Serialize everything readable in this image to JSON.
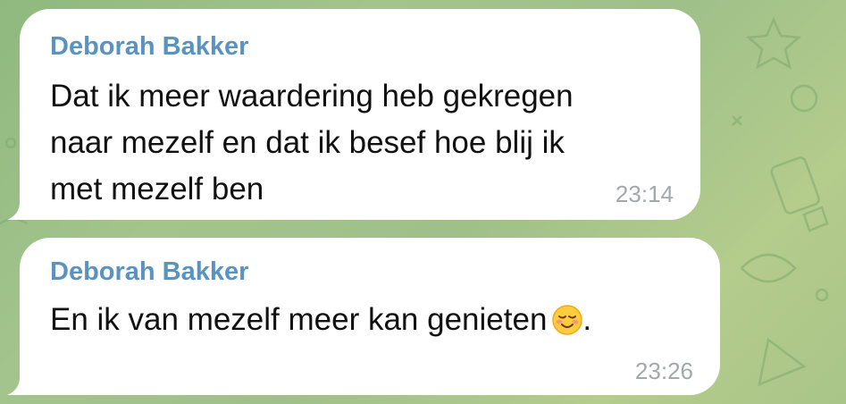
{
  "chat": {
    "messages": [
      {
        "sender": "Deborah Bakker",
        "text": "Dat ik meer waardering heb gekregen\nnaar mezelf en dat ik besef hoe blij ik\nmet mezelf ben",
        "time": "23:14"
      },
      {
        "sender": "Deborah Bakker",
        "text": "En ik van mezelf meer kan genieten",
        "emoji": "smiling-face-emoji",
        "text_end": ".",
        "time": "23:26"
      }
    ]
  },
  "colors": {
    "background": "#9fc08a",
    "bubble": "#ffffff",
    "sender_name": "#5a93be",
    "message_text": "#111111",
    "timestamp": "#a3a8ad"
  }
}
